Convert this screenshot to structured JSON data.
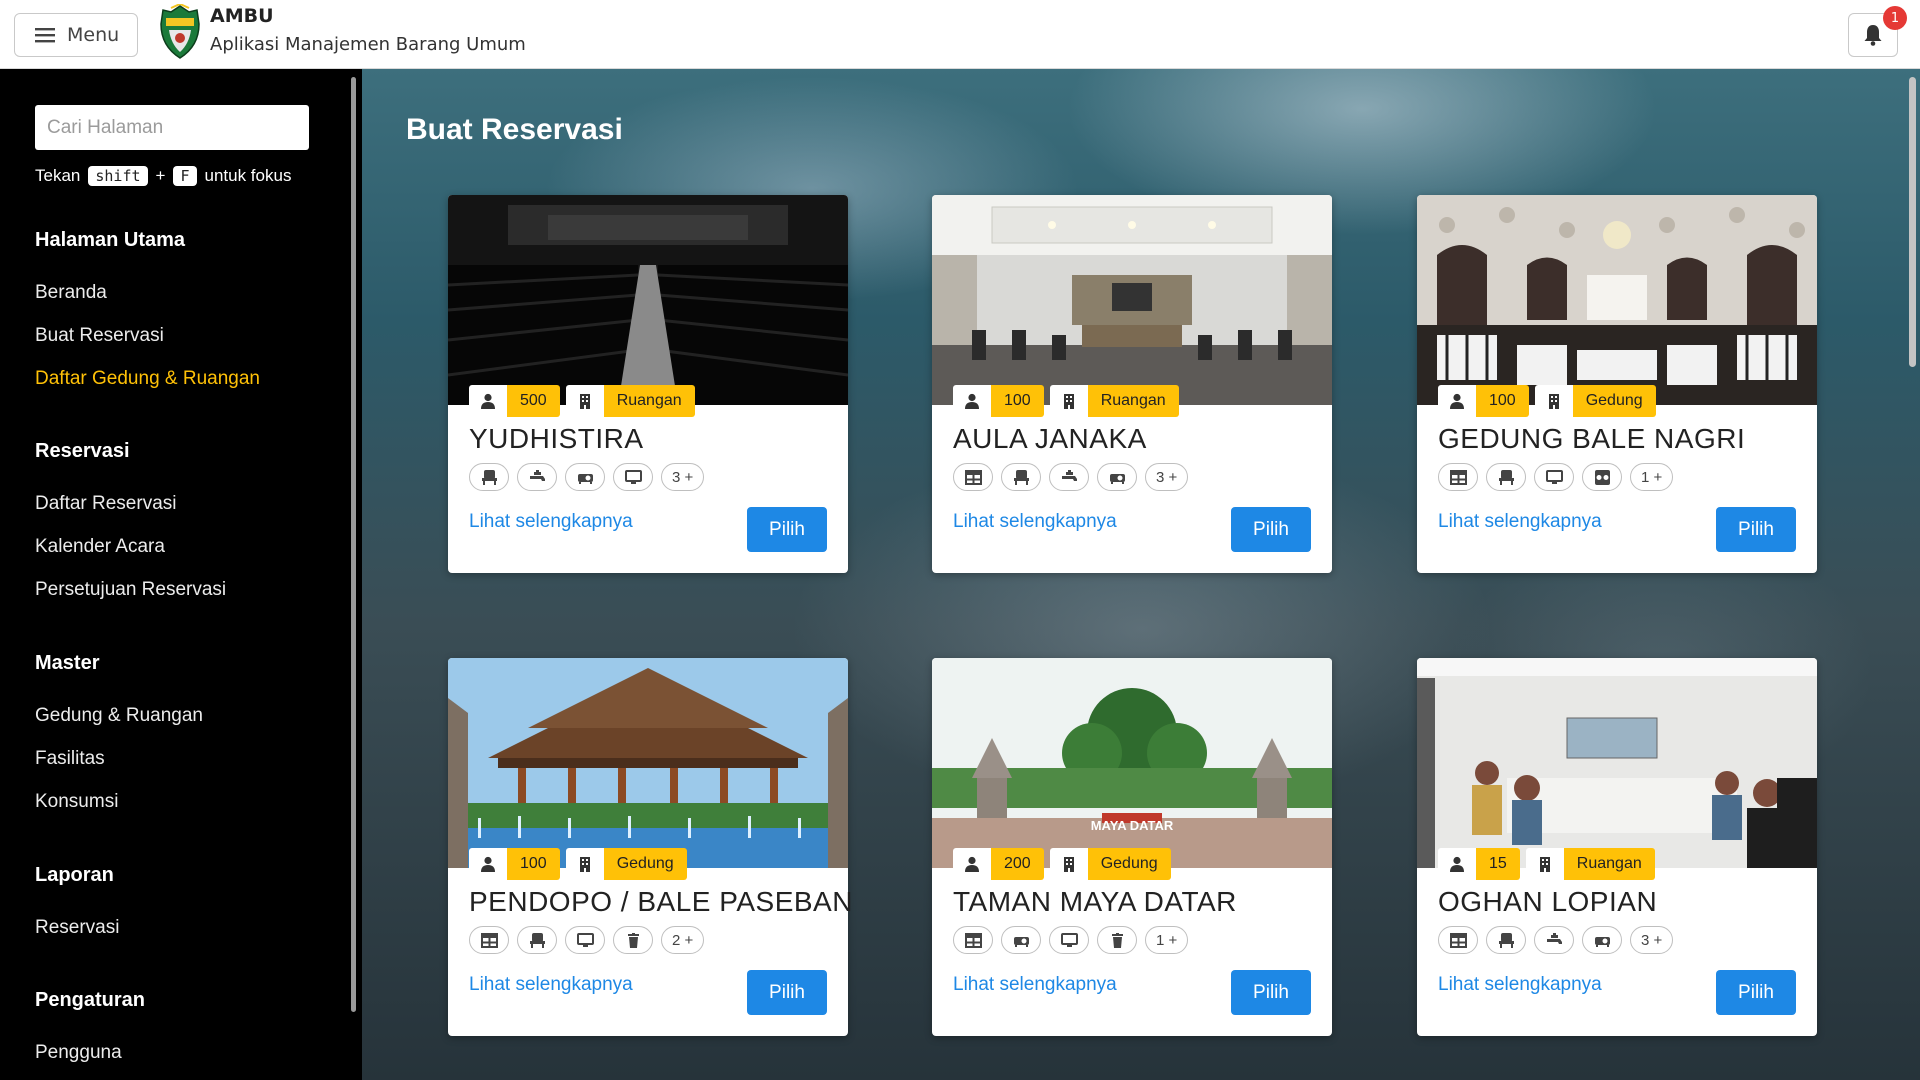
{
  "header": {
    "menu_label": "Menu",
    "app_name": "AMBU",
    "app_subtitle": "Aplikasi Manajemen Barang Umum",
    "notification_count": "1"
  },
  "sidebar": {
    "search_placeholder": "Cari Halaman",
    "hint_prefix": "Tekan",
    "hint_key1": "shift",
    "hint_plus": "+",
    "hint_key2": "F",
    "hint_suffix": "untuk fokus",
    "sections": [
      {
        "title": "Halaman Utama",
        "items": [
          "Beranda",
          "Buat Reservasi",
          "Daftar Gedung & Ruangan"
        ]
      },
      {
        "title": "Reservasi",
        "items": [
          "Daftar Reservasi",
          "Kalender Acara",
          "Persetujuan Reservasi"
        ]
      },
      {
        "title": "Master",
        "items": [
          "Gedung & Ruangan",
          "Fasilitas",
          "Konsumsi"
        ]
      },
      {
        "title": "Laporan",
        "items": [
          "Reservasi"
        ]
      },
      {
        "title": "Pengaturan",
        "items": [
          "Pengguna"
        ]
      }
    ],
    "active_item": "Daftar Gedung & Ruangan"
  },
  "main": {
    "title": "Buat Reservasi",
    "more_label": "Lihat selengkapnya",
    "select_label": "Pilih",
    "cards": [
      {
        "name": "YUDHISTIRA",
        "capacity": "500",
        "type": "Ruangan",
        "facilities": [
          "chair-icon",
          "faucet-icon",
          "projector-icon",
          "monitor-icon"
        ],
        "more_count": "3 +"
      },
      {
        "name": "AULA JANAKA",
        "capacity": "100",
        "type": "Ruangan",
        "facilities": [
          "table-icon",
          "chair-icon",
          "faucet-icon",
          "projector-icon"
        ],
        "more_count": "3 +"
      },
      {
        "name": "GEDUNG BALE NAGRI",
        "capacity": "100",
        "type": "Gedung",
        "facilities": [
          "table-icon",
          "chair-icon",
          "monitor-icon",
          "speaker-icon"
        ],
        "more_count": "1 +"
      },
      {
        "name": "PENDOPO / BALE PASEBAN",
        "capacity": "100",
        "type": "Gedung",
        "facilities": [
          "table-icon",
          "chair-icon",
          "monitor-icon",
          "trash-icon"
        ],
        "more_count": "2 +"
      },
      {
        "name": "TAMAN MAYA DATAR",
        "capacity": "200",
        "type": "Gedung",
        "facilities": [
          "table-icon",
          "projector-icon",
          "monitor-icon",
          "trash-icon"
        ],
        "more_count": "1 +"
      },
      {
        "name": "OGHAN LOPIAN",
        "capacity": "15",
        "type": "Ruangan",
        "facilities": [
          "table-icon",
          "chair-icon",
          "faucet-icon",
          "projector-icon"
        ],
        "more_count": "3 +"
      }
    ],
    "image_signs": {
      "taman": "MAYA DATAR"
    }
  }
}
